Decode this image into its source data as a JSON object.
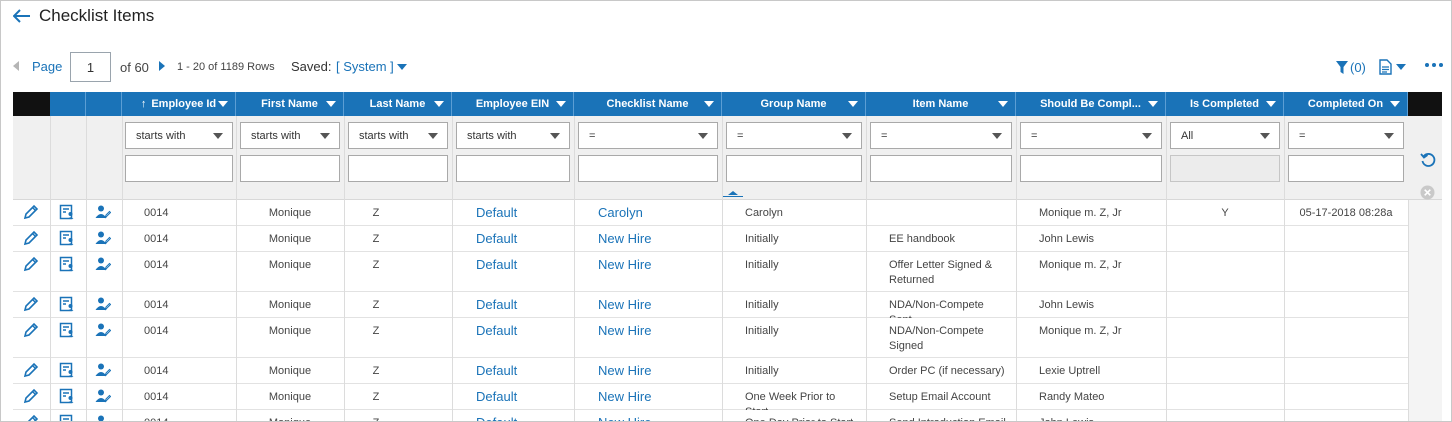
{
  "header": {
    "title": "Checklist Items"
  },
  "pager": {
    "page_label": "Page",
    "page_value": "1",
    "of_pages": "of 60",
    "rows_info": "1 - 20 of 1189 Rows",
    "saved_label": "Saved:",
    "saved_value": "[ System ]"
  },
  "toolbar": {
    "filter_count": "(0)"
  },
  "columns": [
    {
      "label": "Employee Id",
      "sorted": "asc"
    },
    {
      "label": "First Name"
    },
    {
      "label": "Last Name"
    },
    {
      "label": "Employee EIN"
    },
    {
      "label": "Checklist Name"
    },
    {
      "label": "Group Name"
    },
    {
      "label": "Item Name"
    },
    {
      "label": "Should Be Compl..."
    },
    {
      "label": "Is Completed"
    },
    {
      "label": "Completed On"
    }
  ],
  "filters": [
    "starts with",
    "starts with",
    "starts with",
    "starts with",
    "=",
    "=",
    "=",
    "=",
    "All",
    "="
  ],
  "rows": [
    {
      "id": "0014",
      "first": "Monique",
      "last": "Z",
      "ein": "Default",
      "checklist": "Carolyn",
      "group": "Carolyn",
      "item": "",
      "should": "Monique m. Z, Jr",
      "completed": "Y",
      "completed_on": "05-17-2018 08:28a"
    },
    {
      "id": "0014",
      "first": "Monique",
      "last": "Z",
      "ein": "Default",
      "checklist": "New Hire",
      "group": "Initially",
      "item": "EE handbook",
      "should": "John Lewis",
      "completed": "",
      "completed_on": ""
    },
    {
      "id": "0014",
      "first": "Monique",
      "last": "Z",
      "ein": "Default",
      "checklist": "New Hire",
      "group": "Initially",
      "item": "Offer Letter Signed & Returned",
      "should": "Monique m. Z, Jr",
      "completed": "",
      "completed_on": ""
    },
    {
      "id": "0014",
      "first": "Monique",
      "last": "Z",
      "ein": "Default",
      "checklist": "New Hire",
      "group": "Initially",
      "item": "NDA/Non-Compete Sent",
      "should": "John Lewis",
      "completed": "",
      "completed_on": ""
    },
    {
      "id": "0014",
      "first": "Monique",
      "last": "Z",
      "ein": "Default",
      "checklist": "New Hire",
      "group": "Initially",
      "item": "NDA/Non-Compete Signed",
      "should": "Monique m. Z, Jr",
      "completed": "",
      "completed_on": ""
    },
    {
      "id": "0014",
      "first": "Monique",
      "last": "Z",
      "ein": "Default",
      "checklist": "New Hire",
      "group": "Initially",
      "item": "Order PC (if necessary)",
      "should": "Lexie Uptrell",
      "completed": "",
      "completed_on": ""
    },
    {
      "id": "0014",
      "first": "Monique",
      "last": "Z",
      "ein": "Default",
      "checklist": "New Hire",
      "group": "One Week Prior to Start",
      "item": "Setup Email Account",
      "should": "Randy Mateo",
      "completed": "",
      "completed_on": ""
    },
    {
      "id": "0014",
      "first": "Monique",
      "last": "Z",
      "ein": "Default",
      "checklist": "New Hire",
      "group": "One Day Prior to Start",
      "item": "Send Introduction Email",
      "should": "John Lewis",
      "completed": "",
      "completed_on": ""
    }
  ],
  "colors": {
    "accent": "#1a73b8",
    "header_bg": "#1a73b8"
  },
  "icons": [
    "back-arrow-icon",
    "funnel-icon",
    "document-icon",
    "more-icon",
    "refresh-icon",
    "clear-icon",
    "edit-icon",
    "checklist-icon",
    "user-edit-icon"
  ]
}
